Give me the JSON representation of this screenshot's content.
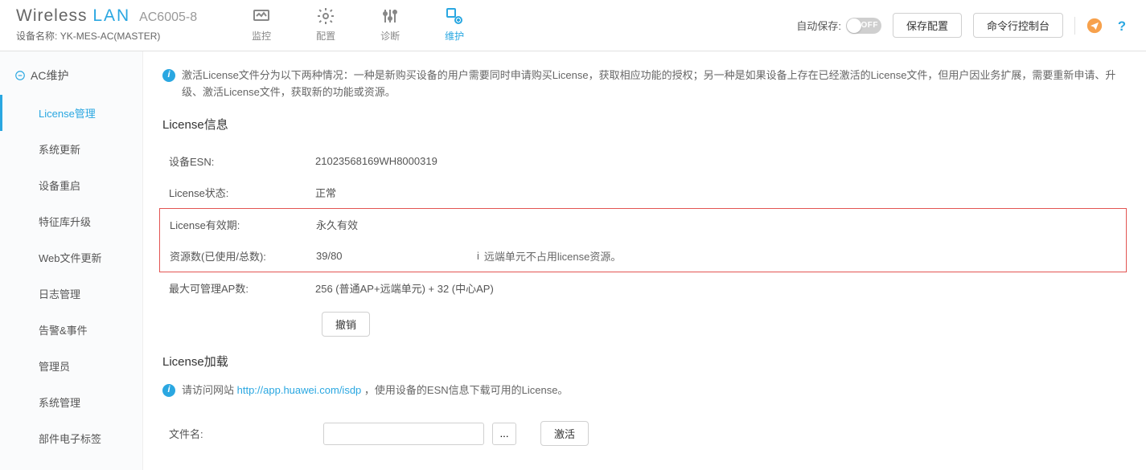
{
  "header": {
    "brand_wireless": "Wireless",
    "brand_lan": "LAN",
    "model": "AC6005-8",
    "device_label": "设备名称:",
    "device_name": "YK-MES-AC(MASTER)",
    "nav": {
      "monitor": "监控",
      "config": "配置",
      "diagnose": "诊断",
      "maintain": "维护"
    },
    "autosave_label": "自动保存:",
    "toggle_text": "OFF",
    "save_btn": "保存配置",
    "cli_btn": "命令行控制台"
  },
  "sidebar": {
    "top": "AC维护",
    "items": [
      "License管理",
      "系统更新",
      "设备重启",
      "特征库升级",
      "Web文件更新",
      "日志管理",
      "告警&事件",
      "管理员",
      "系统管理",
      "部件电子标签"
    ]
  },
  "main": {
    "banner": "激活License文件分为以下两种情况：一种是新购买设备的用户需要同时申请购买License，获取相应功能的授权；另一种是如果设备上存在已经激活的License文件，但用户因业务扩展，需要重新申请、升级、激活License文件，获取新的功能或资源。",
    "license_info_title": "License信息",
    "rows": {
      "esn_label": "设备ESN:",
      "esn_val": "21023568169WH8000319",
      "status_label": "License状态:",
      "status_val": "正常",
      "expire_label": "License有效期:",
      "expire_val": "永久有效",
      "res_label": "资源数(已使用/总数):",
      "res_val": "39/80",
      "res_note": "远端单元不占用license资源。",
      "maxap_label": "最大可管理AP数:",
      "maxap_val": "256 (普通AP+远端单元) + 32 (中心AP)"
    },
    "revoke_btn": "撤销",
    "load_title": "License加载",
    "load_banner_prefix": "请访问网站 ",
    "load_banner_link": "http://app.huawei.com/isdp",
    "load_banner_suffix": " ，使用设备的ESN信息下载可用的License。",
    "file_label": "文件名:",
    "browse_btn": "...",
    "activate_btn": "激活"
  }
}
